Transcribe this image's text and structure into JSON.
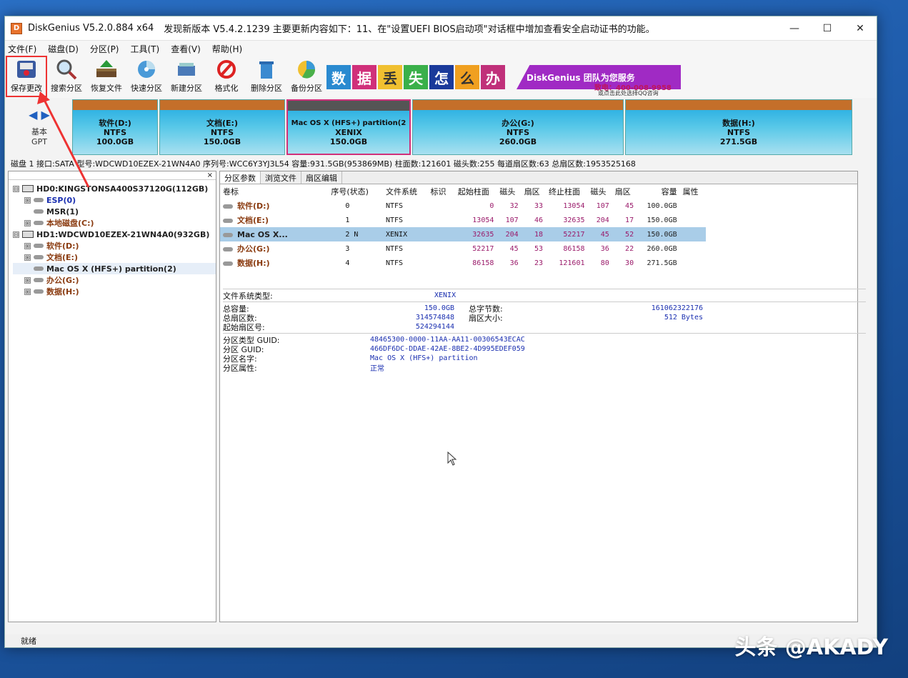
{
  "window": {
    "title": "DiskGenius V5.2.0.884 x64",
    "news": "发现新版本 V5.4.2.1239 主要更新内容如下：11、在\"设置UEFI BIOS启动项\"对话框中增加查看安全启动证书的功能。",
    "minimize": "—",
    "maximize": "☐",
    "close": "✕"
  },
  "menu": [
    "文件(F)",
    "磁盘(D)",
    "分区(P)",
    "工具(T)",
    "查看(V)",
    "帮助(H)"
  ],
  "toolbar": [
    {
      "label": "保存更改",
      "icon": "save-icon"
    },
    {
      "label": "搜索分区",
      "icon": "magnifier-icon"
    },
    {
      "label": "恢复文件",
      "icon": "restore-icon"
    },
    {
      "label": "快速分区",
      "icon": "quick-partition-icon"
    },
    {
      "label": "新建分区",
      "icon": "new-partition-icon"
    },
    {
      "label": "格式化",
      "icon": "format-icon"
    },
    {
      "label": "删除分区",
      "icon": "delete-icon"
    },
    {
      "label": "备份分区",
      "icon": "backup-icon"
    }
  ],
  "banner": {
    "chars": [
      "数",
      "据",
      "丢",
      "失",
      "怎",
      "么",
      "办"
    ],
    "slogan": "DiskGenius 团队为您服务",
    "tel": "致电：400-008-9958",
    "qq": "或点击此处选择QQ咨询"
  },
  "diskmap": {
    "nav": "◀ ▶",
    "type": "基本",
    "scheme": "GPT",
    "partitions": [
      {
        "name": "软件(D:)",
        "fs": "NTFS",
        "size": "100.0GB"
      },
      {
        "name": "文档(E:)",
        "fs": "NTFS",
        "size": "150.0GB"
      },
      {
        "name": "Mac OS X (HFS+) partition(2",
        "fs": "XENIX",
        "size": "150.0GB"
      },
      {
        "name": "办公(G:)",
        "fs": "NTFS",
        "size": "260.0GB"
      },
      {
        "name": "数据(H:)",
        "fs": "NTFS",
        "size": "271.5GB"
      }
    ]
  },
  "diskinfo": "磁盘 1 接口:SATA  型号:WDCWD10EZEX-21WN4A0  序列号:WCC6Y3YJ3L54  容量:931.5GB(953869MB)  柱面数:121601  磁头数:255  每道扇区数:63  总扇区数:1953525168",
  "tree": {
    "close": "×",
    "items": [
      {
        "text": "HD0:KINGSTONSA400S37120G(112GB)",
        "level": 0,
        "kind": "disk",
        "exp": "⊟"
      },
      {
        "text": "ESP(0)",
        "level": 1,
        "kind": "part",
        "exp": "⊞",
        "color": "blue"
      },
      {
        "text": "MSR(1)",
        "level": 1,
        "kind": "part",
        "exp": "",
        "color": "dark"
      },
      {
        "text": "本地磁盘(C:)",
        "level": 1,
        "kind": "part",
        "exp": "⊞",
        "color": "brown"
      },
      {
        "text": "HD1:WDCWD10EZEX-21WN4A0(932GB)",
        "level": 0,
        "kind": "disk",
        "exp": "⊟"
      },
      {
        "text": "软件(D:)",
        "level": 1,
        "kind": "part",
        "exp": "⊞",
        "color": "brown"
      },
      {
        "text": "文档(E:)",
        "level": 1,
        "kind": "part",
        "exp": "⊞",
        "color": "brown"
      },
      {
        "text": "Mac OS X (HFS+) partition(2)",
        "level": 1,
        "kind": "part",
        "exp": "",
        "color": "dark"
      },
      {
        "text": "办公(G:)",
        "level": 1,
        "kind": "part",
        "exp": "⊞",
        "color": "brown"
      },
      {
        "text": "数据(H:)",
        "level": 1,
        "kind": "part",
        "exp": "⊞",
        "color": "brown"
      }
    ]
  },
  "tabs": [
    "分区参数",
    "浏览文件",
    "扇区编辑"
  ],
  "table": {
    "headers": [
      "卷标",
      "序号(状态)",
      "文件系统",
      "标识",
      "起始柱面",
      "磁头",
      "扇区",
      "终止柱面",
      "磁头",
      "扇区",
      "容量",
      "属性"
    ],
    "rows": [
      [
        "软件(D:)",
        "0",
        "NTFS",
        "",
        "0",
        "32",
        "33",
        "13054",
        "107",
        "45",
        "100.0GB",
        ""
      ],
      [
        "文档(E:)",
        "1",
        "NTFS",
        "",
        "13054",
        "107",
        "46",
        "32635",
        "204",
        "17",
        "150.0GB",
        ""
      ],
      [
        "Mac OS X...",
        "2 N",
        "XENIX",
        "",
        "32635",
        "204",
        "18",
        "52217",
        "45",
        "52",
        "150.0GB",
        ""
      ],
      [
        "办公(G:)",
        "3",
        "NTFS",
        "",
        "52217",
        "45",
        "53",
        "86158",
        "36",
        "22",
        "260.0GB",
        ""
      ],
      [
        "数据(H:)",
        "4",
        "NTFS",
        "",
        "86158",
        "36",
        "23",
        "121601",
        "80",
        "30",
        "271.5GB",
        ""
      ]
    ],
    "selected": 2
  },
  "details": {
    "fs_type_label": "文件系统类型:",
    "fs_type": "XENIX",
    "total_cap_label": "总容量:",
    "total_cap": "150.0GB",
    "total_bytes_label": "总字节数:",
    "total_bytes": "161062322176",
    "total_sectors_label": "总扇区数:",
    "total_sectors": "314574848",
    "sector_size_label": "扇区大小:",
    "sector_size": "512 Bytes",
    "start_sector_label": "起始扇区号:",
    "start_sector": "524294144",
    "type_guid_label": "分区类型 GUID:",
    "type_guid": "48465300-0000-11AA-AA11-00306543ECAC",
    "part_guid_label": "分区 GUID:",
    "part_guid": "466DF6DC-DDAE-42AE-8BE2-4D995EDEF059",
    "part_name_label": "分区名字:",
    "part_name": "Mac OS X (HFS+) partition",
    "part_attr_label": "分区属性:",
    "part_attr": "正常"
  },
  "status": "就绪",
  "watermark": "头条 @AKADY"
}
